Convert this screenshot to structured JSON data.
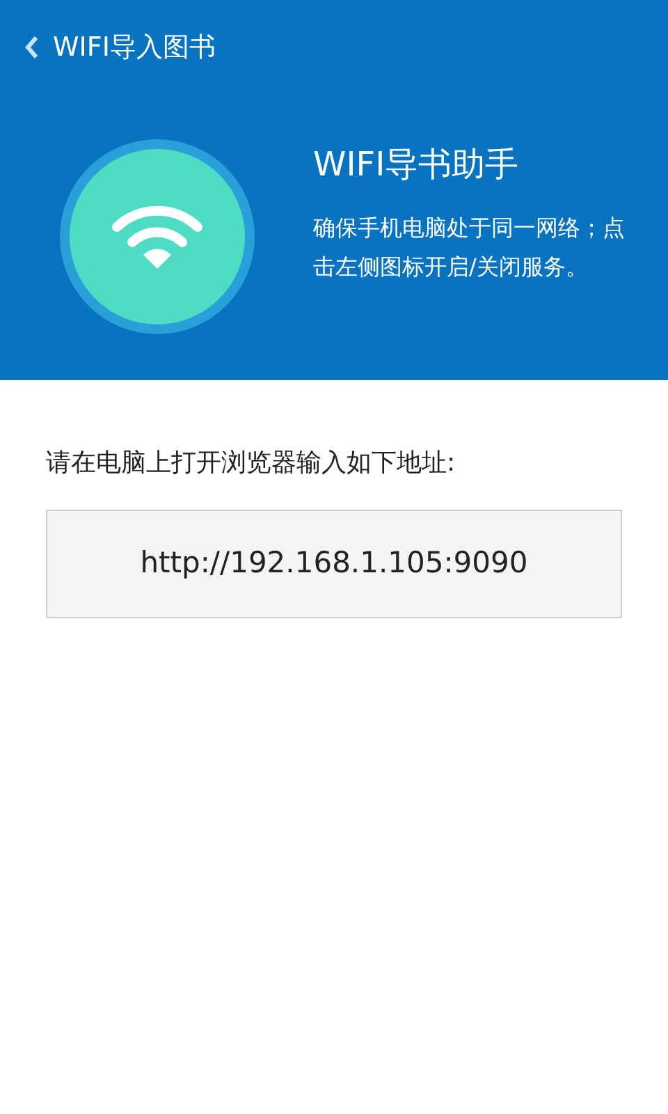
{
  "top_bar": {
    "title": "WIFI导入图书"
  },
  "header": {
    "title": "WIFI导书助手",
    "description": "确保手机电脑处于同一网络；点击左侧图标开启/关闭服务。"
  },
  "instruction": "请在电脑上打开浏览器输入如下地址:",
  "address": "http://192.168.1.105:9090"
}
